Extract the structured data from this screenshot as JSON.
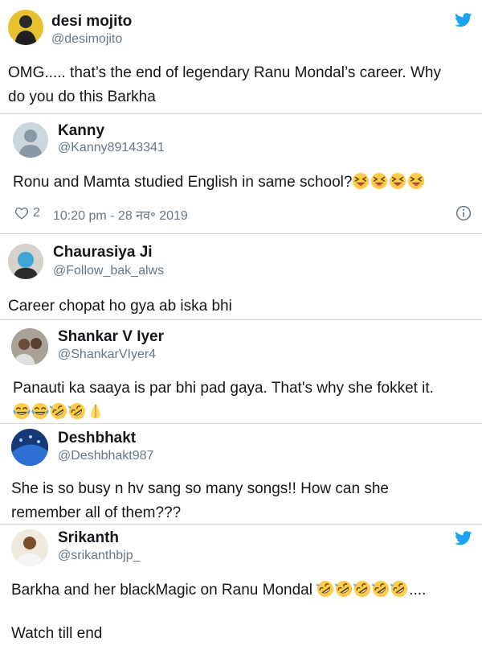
{
  "tweets": [
    {
      "name": "desi mojito",
      "handle": "@desimojito",
      "text_lines": [
        "OMG..... that’s the end of legendary Ranu Mondal’s career. Why",
        "do you do this Barkha"
      ],
      "twitter_icon": "twitter-bird-icon"
    },
    {
      "name": "Kanny",
      "handle": "@Kanny89143341",
      "text": "Ronu and Mamta studied English in same school?",
      "emojis": [
        "squinting-tongue",
        "squinting-tongue",
        "squinting-tongue",
        "squinting-tongue"
      ],
      "likes": "2",
      "timestamp": "10:20 pm - 28 नव॰ 2019"
    },
    {
      "name": "Chaurasiya Ji",
      "handle": "@Follow_bak_alws",
      "text": "Career chopat ho gya ab iska bhi"
    },
    {
      "name": "Shankar V Iyer",
      "handle": "@ShankarVIyer4",
      "text": "Panauti ka saaya is par bhi pad gaya. That's why she fokket it.",
      "emojis": [
        "tears-of-joy",
        "tears-of-joy",
        "rofl",
        "rofl",
        "folded-hands"
      ]
    },
    {
      "name": "Deshbhakt",
      "handle": "@Deshbhakt987",
      "text_lines": [
        "She is so busy n hv sang so many songs!! How can she",
        "remember all of them???"
      ]
    },
    {
      "name": "Srikanth",
      "handle": "@srikanthbjp_",
      "text": "Barkha and her blackMagic on Ranu Mondal",
      "emojis": [
        "rofl",
        "rofl",
        "rofl",
        "rofl",
        "rofl"
      ],
      "text_suffix": "....",
      "text_line2": "Watch till end",
      "twitter_icon": "twitter-bird-icon"
    }
  ],
  "colors": {
    "twitter_blue": "#1da1f2",
    "handle_gray": "#657786",
    "separator": "#d6d6d6"
  }
}
